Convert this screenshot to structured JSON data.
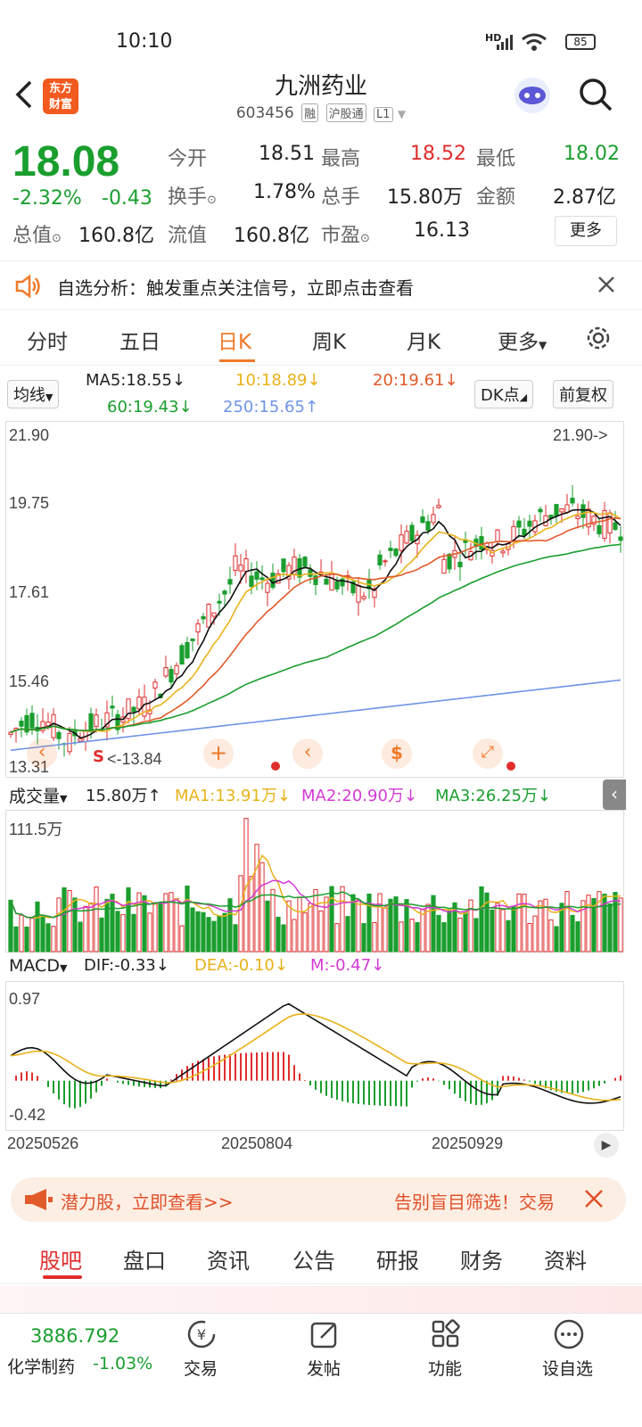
{
  "status": {
    "time": "10:10",
    "battery": "85",
    "network": "HD"
  },
  "header": {
    "logo_line1": "东方",
    "logo_line2": "财富",
    "stock_name": "九洲药业",
    "stock_code": "603456",
    "tags": [
      "融",
      "沪股通",
      "L1"
    ]
  },
  "quote": {
    "price": "18.08",
    "change_pct": "-2.32%",
    "change": "-0.43",
    "labels": {
      "open": "今开",
      "high": "最高",
      "low": "最低",
      "turnover": "换手",
      "volume": "总手",
      "amount": "金额",
      "market_cap": "总值",
      "float_cap": "流值",
      "pe": "市盈"
    },
    "open": "18.51",
    "high": "18.52",
    "low": "18.02",
    "turnover_rate": "1.78%",
    "volume": "15.80万",
    "amount": "2.87亿",
    "market_cap": "160.8亿",
    "float_cap": "160.8亿",
    "pe": "16.13",
    "more_label": "更多"
  },
  "notice": {
    "text": "自选分析：触发重点关注信号，立即点击查看"
  },
  "period_tabs": [
    "分时",
    "五日",
    "日K",
    "周K",
    "月K",
    "更多"
  ],
  "active_tab": "日K",
  "ma": {
    "selector": "均线",
    "ma5": "MA5:18.55",
    "ma10": "10:18.89",
    "ma20": "20:19.61",
    "ma60": "60:19.43",
    "ma250": "250:15.65",
    "dk_label": "DK点",
    "fq_label": "前复权"
  },
  "price_axis": [
    "21.90",
    "19.75",
    "17.61",
    "15.46",
    "13.31"
  ],
  "price_marks": {
    "high_mark": "21.90->",
    "low_mark": "<-13.84",
    "s_label": "S"
  },
  "volume": {
    "selector": "成交量",
    "value": "15.80万",
    "ma1": "MA1:13.91万",
    "ma2": "MA2:20.90万",
    "ma3": "MA3:26.25万",
    "max_label": "111.5万"
  },
  "macd": {
    "selector": "MACD",
    "dif": "DIF:-0.33",
    "dea": "DEA:-0.10",
    "m": "M:-0.47",
    "top_label": "0.97",
    "bottom_label": "-0.42"
  },
  "dates": [
    "20250526",
    "20250804",
    "20250929"
  ],
  "ad_banner": {
    "left_text": "潜力股，立即查看>>",
    "right_text": "告别盲目筛选！交易"
  },
  "bottom_tabs": [
    "股吧",
    "盘口",
    "资讯",
    "公告",
    "研报",
    "财务",
    "资料"
  ],
  "toolbar": {
    "index_value": "3886.792",
    "index_name": "化学制药",
    "index_change": "-1.03%",
    "items": [
      "交易",
      "发帖",
      "功能",
      "设自选"
    ]
  },
  "colors": {
    "up": "#e02d2d",
    "down": "#1a9e2e",
    "accent": "#f07a2a"
  }
}
